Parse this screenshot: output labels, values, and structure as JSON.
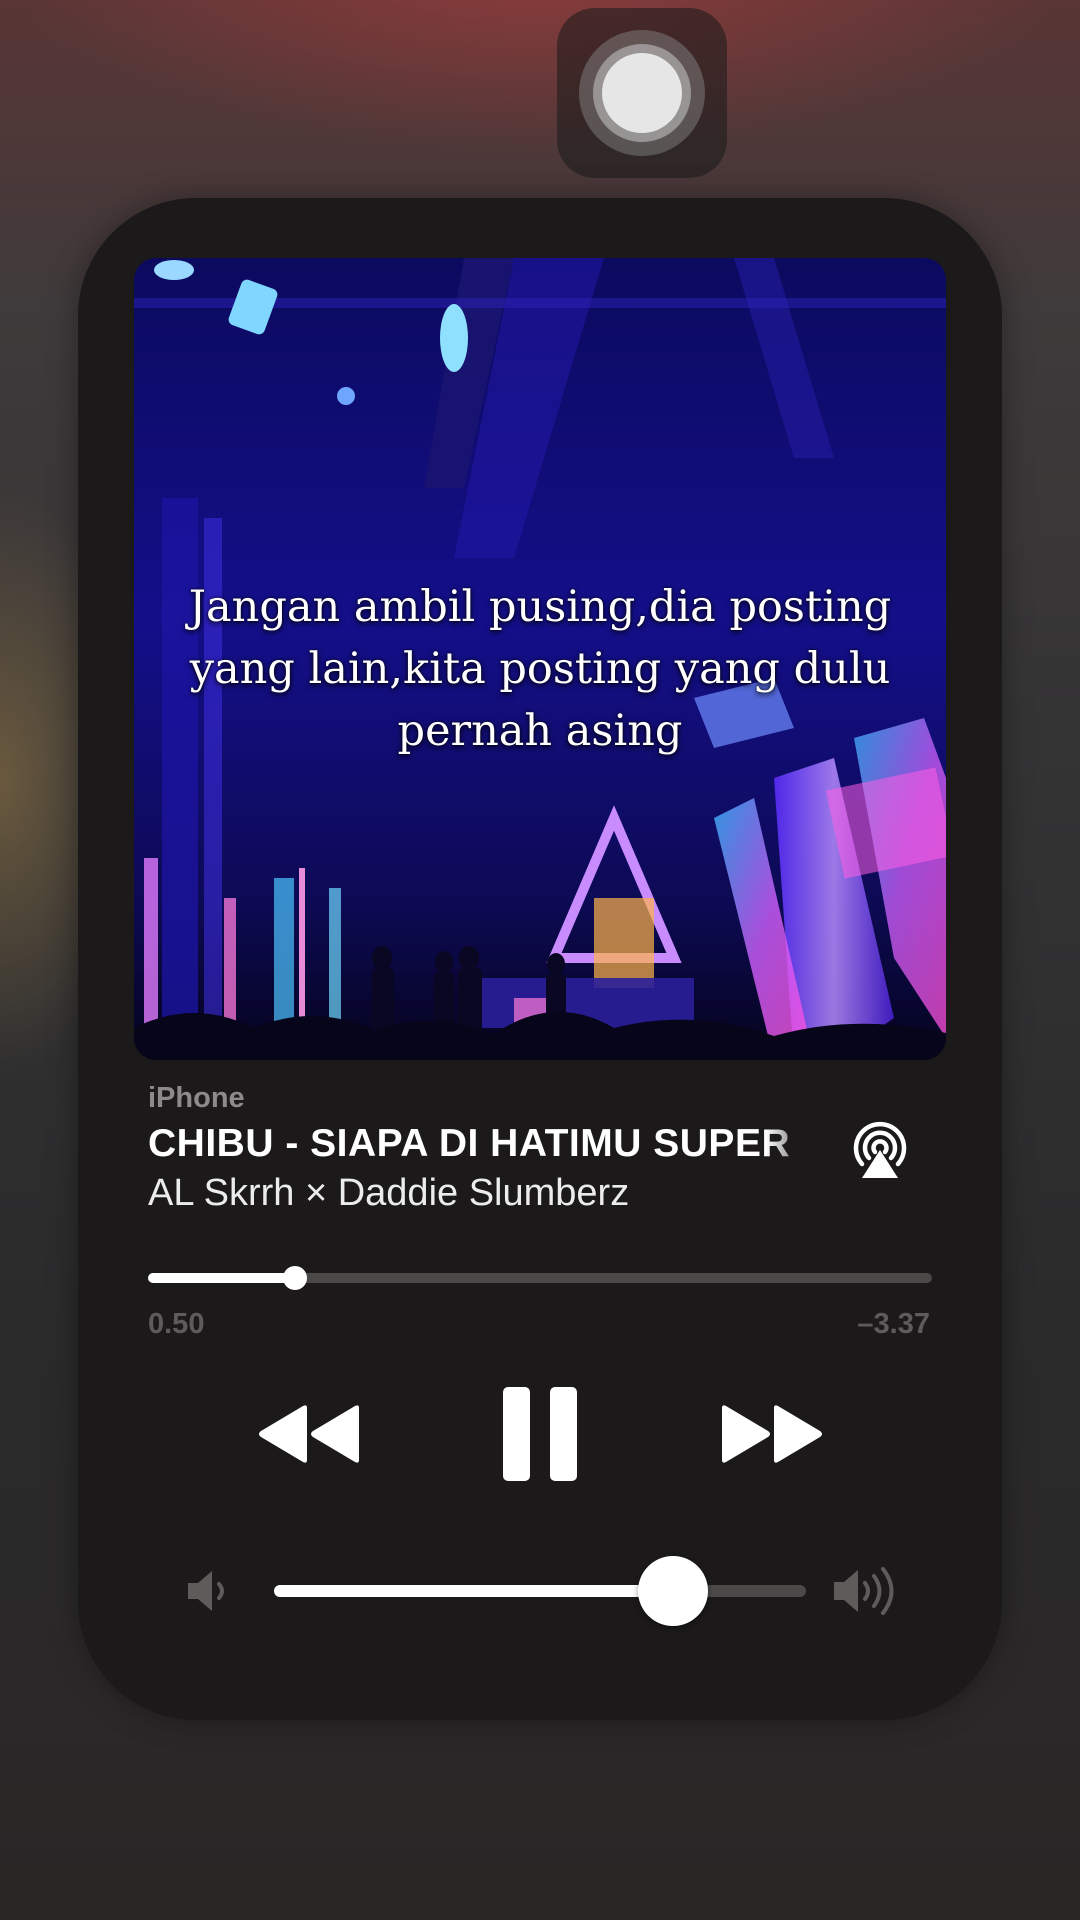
{
  "player": {
    "device_name": "iPhone",
    "track_title": "CHIBU - SIAPA DI HATIMU SUPER",
    "artist": "AL Skrrh × Daddie Slumberz",
    "artwork_lyrics": "Jangan ambil pusing,dia posting yang lain,kita posting yang dulu pernah asing",
    "time_elapsed": "0.50",
    "time_remaining": "–3.37",
    "progress_fraction": 0.187,
    "volume_fraction": 0.75,
    "is_playing": true
  },
  "icons": {
    "assistive_touch": "assistive-touch-icon",
    "airplay": "airplay-icon",
    "rewind": "rewind-icon",
    "pause": "pause-icon",
    "forward": "fast-forward-icon",
    "volume_low": "speaker-low-icon",
    "volume_high": "speaker-high-icon"
  },
  "colors": {
    "card_background": "#1b1919",
    "primary_text": "#ffffff",
    "secondary_text": "#8c8a8a",
    "time_text": "#5e5b5b",
    "slider_track": "#4b4848",
    "slider_fill": "#ffffff"
  }
}
